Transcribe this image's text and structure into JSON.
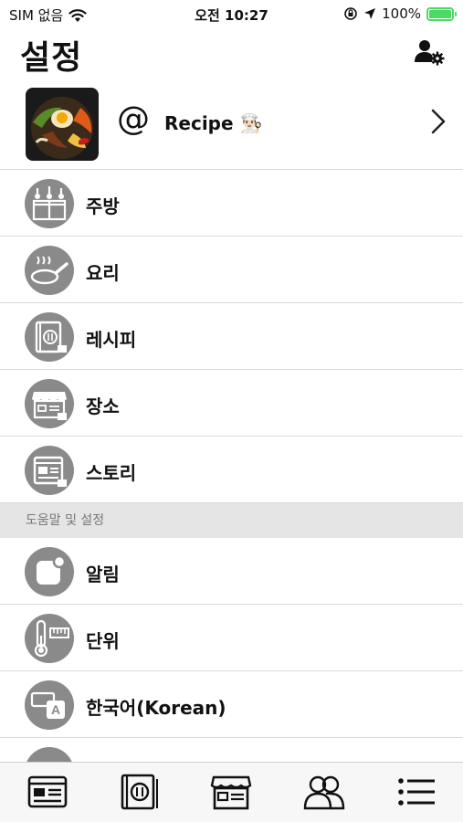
{
  "status_bar": {
    "carrier": "SIM 없음",
    "time": "오전 10:27",
    "battery_percent": "100%"
  },
  "header": {
    "title": "설정",
    "profile_settings_icon": "person-gear-icon"
  },
  "profile": {
    "at_symbol": "@",
    "name": "Recipe 👨🏻‍🍳",
    "thumbnail": "bibimbap-photo"
  },
  "menu_items": [
    {
      "label": "주방",
      "icon": "kitchen-icon"
    },
    {
      "label": "요리",
      "icon": "frying-pan-icon"
    },
    {
      "label": "레시피",
      "icon": "recipe-book-icon"
    },
    {
      "label": "장소",
      "icon": "store-icon"
    },
    {
      "label": "스토리",
      "icon": "story-icon"
    }
  ],
  "section_help": {
    "title": "도움말 및 설정",
    "items": [
      {
        "label": "알림",
        "icon": "notification-icon"
      },
      {
        "label": "단위",
        "icon": "thermometer-ruler-icon"
      },
      {
        "label": "한국어(Korean)",
        "icon": "language-icon"
      }
    ]
  },
  "tab_bar": [
    {
      "icon": "story-tab-icon"
    },
    {
      "icon": "recipes-tab-icon"
    },
    {
      "icon": "store-tab-icon"
    },
    {
      "icon": "people-tab-icon"
    },
    {
      "icon": "menu-list-tab-icon"
    }
  ],
  "colors": {
    "icon_gray": "#8a8a8a",
    "battery_green": "#4cd964",
    "section_bg": "#e5e5e5",
    "divider": "#d9d9d9"
  }
}
